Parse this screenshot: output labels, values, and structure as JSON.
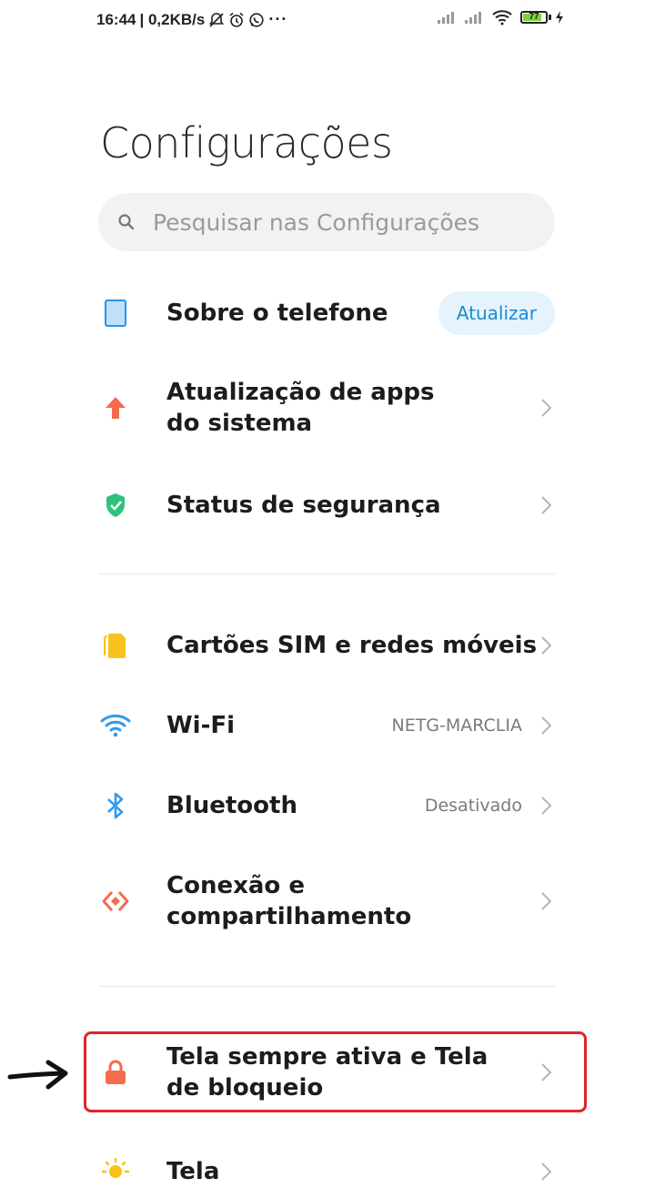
{
  "status_bar": {
    "time": "16:44",
    "speed": "| 0,2KB/s",
    "battery": "77"
  },
  "page_title": "Configurações",
  "search": {
    "placeholder": "Pesquisar nas Configurações"
  },
  "items": [
    {
      "label": "Sobre o telefone",
      "action": "Atualizar",
      "icon": "phone-icon",
      "color": "#2196f3"
    },
    {
      "label": "Atualização de apps do sistema",
      "icon": "upload-arrow-icon",
      "color": "#f56b4f"
    },
    {
      "label": "Status de segurança",
      "icon": "shield-check-icon",
      "color": "#2ec27e"
    },
    {
      "label": "Cartões SIM e redes móveis",
      "icon": "sim-card-icon",
      "color": "#f7c21b"
    },
    {
      "label": "Wi-Fi",
      "value": "NETG-MARCLIA",
      "icon": "wifi-icon",
      "color": "#2e9bf0"
    },
    {
      "label": "Bluetooth",
      "value": "Desativado",
      "icon": "bluetooth-icon",
      "color": "#2e9bf0"
    },
    {
      "label": "Conexão e compartilhamento",
      "icon": "share-connection-icon",
      "color": "#f56b4f"
    },
    {
      "label": "Tela sempre ativa e Tela de bloqueio",
      "icon": "lock-icon",
      "color": "#f56b4f"
    },
    {
      "label": "Tela",
      "icon": "sun-icon",
      "color": "#f7c21b"
    }
  ]
}
